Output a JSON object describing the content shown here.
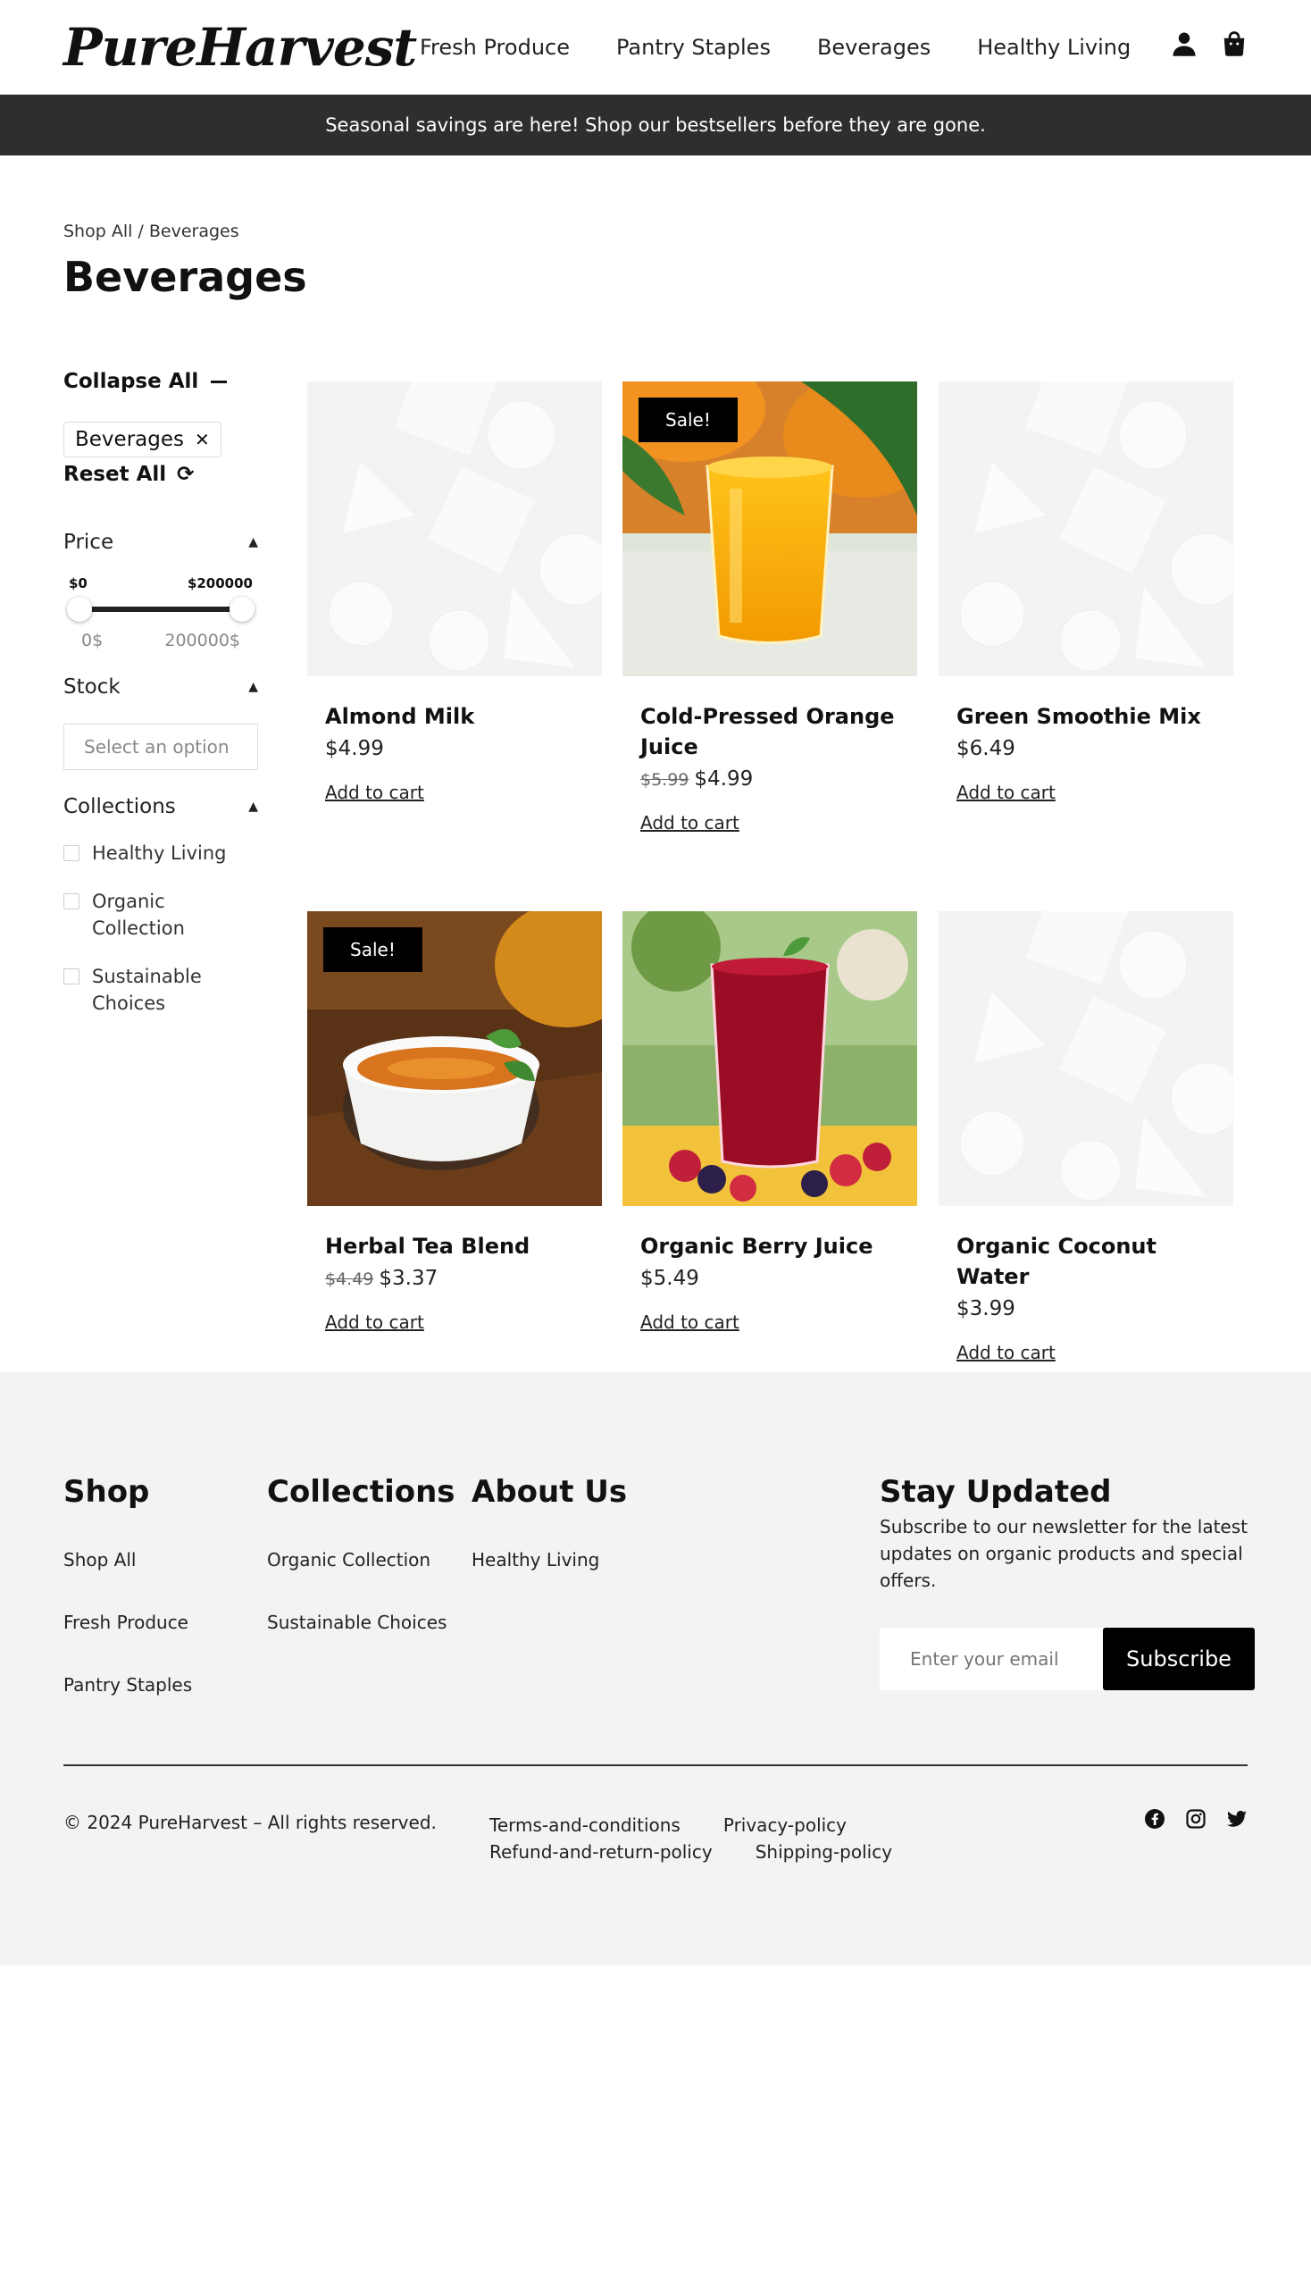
{
  "brand": {
    "logo": "PureHarvest"
  },
  "nav": [
    "Fresh Produce",
    "Pantry Staples",
    "Beverages",
    "Healthy Living"
  ],
  "promo": "Seasonal savings are here! Shop our bestsellers before they are gone.",
  "breadcrumb": "Shop All / Beverages",
  "page_title": "Beverages",
  "filters": {
    "collapse_all": "Collapse All",
    "active_chip": "Beverages",
    "reset_all": "Reset All",
    "price": {
      "label": "Price",
      "min_label": "$0",
      "max_label": "$200000",
      "min_value": "0$",
      "max_value": "200000$"
    },
    "stock": {
      "label": "Stock",
      "placeholder": "Select an option"
    },
    "collections": {
      "label": "Collections",
      "items": [
        "Healthy Living",
        "Organic Collection",
        "Sustainable Choices"
      ]
    }
  },
  "products": [
    {
      "name": "Almond Milk",
      "old_price": "",
      "price": "$4.99",
      "sale": "",
      "cta": "Add to cart"
    },
    {
      "name": "Cold-Pressed Orange Juice",
      "old_price": "$5.99",
      "price": "$4.99",
      "sale": "Sale!",
      "cta": "Add to cart"
    },
    {
      "name": "Green Smoothie Mix",
      "old_price": "",
      "price": "$6.49",
      "sale": "",
      "cta": "Add to cart"
    },
    {
      "name": "Herbal Tea Blend",
      "old_price": "$4.49",
      "price": "$3.37",
      "sale": "Sale!",
      "cta": "Add to cart"
    },
    {
      "name": "Organic Berry Juice",
      "old_price": "",
      "price": "$5.49",
      "sale": "",
      "cta": "Add to cart"
    },
    {
      "name": "Organic Coconut Water",
      "old_price": "",
      "price": "$3.99",
      "sale": "",
      "cta": "Add to cart"
    }
  ],
  "footer": {
    "shop": {
      "title": "Shop",
      "links": [
        "Shop All",
        "Fresh Produce",
        "Pantry Staples"
      ]
    },
    "collections": {
      "title": "Collections",
      "links": [
        "Organic Collection",
        "Sustainable Choices"
      ]
    },
    "about": {
      "title": "About Us",
      "links": [
        "Healthy Living"
      ]
    },
    "newsletter": {
      "title": "Stay Updated",
      "text": "Subscribe to our newsletter for the latest updates on organic products and special offers.",
      "placeholder": "Enter your email",
      "button": "Subscribe"
    },
    "copyright": "© 2024 PureHarvest – All rights reserved.",
    "legal": [
      "Terms-and-conditions",
      "Privacy-policy",
      "Refund-and-return-policy",
      "Shipping-policy"
    ]
  },
  "icons": {
    "account": "user-icon",
    "cart": "bag-icon",
    "social": [
      "facebook-icon",
      "instagram-icon",
      "twitter-icon"
    ]
  }
}
